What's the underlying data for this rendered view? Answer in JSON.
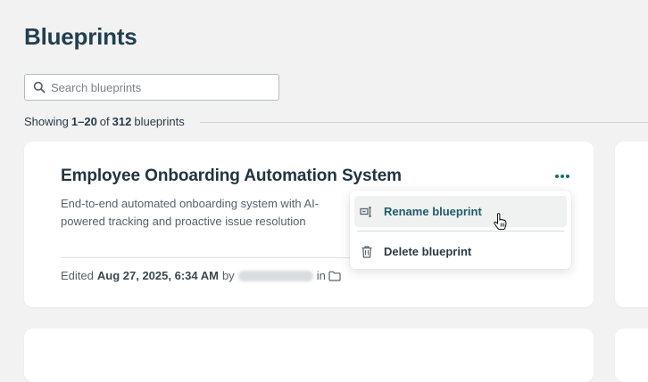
{
  "page": {
    "title": "Blueprints"
  },
  "search": {
    "placeholder": "Search blueprints",
    "value": ""
  },
  "results": {
    "prefix": "Showing",
    "range": "1–20",
    "of": "of",
    "total": "312",
    "suffix": "blueprints"
  },
  "card": {
    "title": "Employee Onboarding Automation System",
    "description": "End-to-end automated onboarding system with AI-powered tracking and proactive issue resolution",
    "meta": {
      "edited_label": "Edited",
      "edited_date": "Aug 27, 2025, 6:34 AM",
      "by_label": "by",
      "in_label": "in"
    }
  },
  "menu": {
    "items": [
      {
        "label": "Rename blueprint",
        "icon": "rename-icon"
      },
      {
        "label": "Delete blueprint",
        "icon": "trash-icon"
      }
    ]
  },
  "colors": {
    "accent": "#156f6f",
    "title": "#213f4f",
    "background": "#f2f2f2"
  }
}
